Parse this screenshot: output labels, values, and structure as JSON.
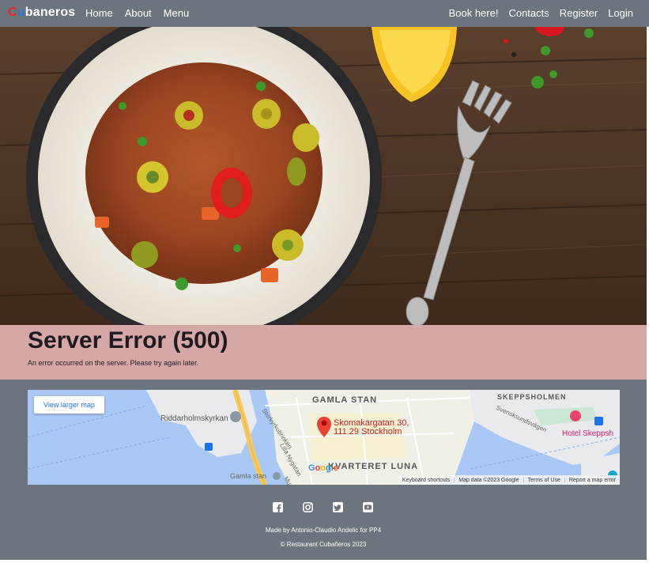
{
  "nav": {
    "brand_letters": [
      {
        "char": "C",
        "color": "#e8262f"
      },
      {
        "char": "u",
        "color": "#2e7bd6"
      },
      {
        "char": "b",
        "color": "#ffffff"
      },
      {
        "char": "aneros",
        "color": "#ffffff"
      }
    ],
    "left_links": [
      "Home",
      "About",
      "Menu"
    ],
    "right_links": [
      "Book here!",
      "Contacts",
      "Register",
      "Login"
    ]
  },
  "hero": {
    "image_description_icon": "food-photo"
  },
  "error": {
    "title": "Server Error (500)",
    "message": "An error occurred on the server. Please try again later."
  },
  "map": {
    "view_larger_label": "View larger map",
    "address_line1": "Skomakargatan 30,",
    "address_line2": "111 29 Stockholm",
    "labels": {
      "gamla_stan": "GAMLA STAN",
      "skeppsholmen": "SKEPPSHOLMEN",
      "riddarholmskyrkan": "Riddarholmskyrkan",
      "kvarteret_luna": "KVARTERET LUNA",
      "hotel": "Hotel Skeppsh",
      "gamla_stan_station": "Gamla stan",
      "storkyrkobrinken": "Storkyrkobrinken",
      "lilla_nygatan": "Lilla Nygatan",
      "svenska": "Svensksundsvägen",
      "munk": "Munk"
    },
    "google_logo": "Google",
    "footer": [
      "Keyboard shortcuts",
      "Map data ©2023 Google",
      "Terms of Use",
      "Report a map error"
    ]
  },
  "footer": {
    "social_icons": [
      "facebook-icon",
      "instagram-icon",
      "twitter-icon",
      "youtube-icon"
    ],
    "made_by": "Made by Antonio-Claudio Andelic for PP4",
    "copyright": "© Restaurant Cubañeros 2023"
  },
  "colors": {
    "navbar_bg": "#6c757d",
    "error_bg": "#d7a6a6",
    "brand_red": "#e8262f",
    "brand_blue": "#2e7bd6"
  }
}
